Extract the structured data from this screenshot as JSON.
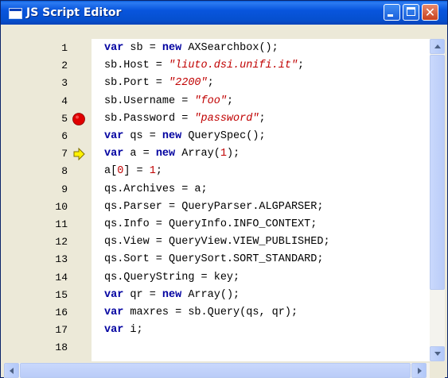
{
  "window": {
    "title": "JS Script Editor",
    "title_icon": "window-icon",
    "controls": {
      "minimize_icon": "minimize-icon",
      "maximize_icon": "maximize-icon",
      "close_icon": "close-icon",
      "close_glyph": "✕"
    }
  },
  "colors": {
    "keyword": "#0000A0",
    "string": "#C00000",
    "breakpoint": "#E00000",
    "current_line_arrow": "#FFF200"
  },
  "editor": {
    "lines": [
      {
        "n": "1",
        "marker": "",
        "tokens": [
          {
            "t": "var",
            "c": "kw"
          },
          {
            "t": " sb = "
          },
          {
            "t": "new",
            "c": "kw"
          },
          {
            "t": " AXSearchbox();"
          }
        ]
      },
      {
        "n": "2",
        "marker": "",
        "tokens": [
          {
            "t": "sb.Host = "
          },
          {
            "t": "\"liuto.dsi.unifi.it\"",
            "c": "str"
          },
          {
            "t": ";"
          }
        ]
      },
      {
        "n": "3",
        "marker": "",
        "tokens": [
          {
            "t": "sb.Port = "
          },
          {
            "t": "\"2200\"",
            "c": "str"
          },
          {
            "t": ";"
          }
        ]
      },
      {
        "n": "4",
        "marker": "",
        "tokens": [
          {
            "t": "sb.Username = "
          },
          {
            "t": "\"foo\"",
            "c": "str"
          },
          {
            "t": ";"
          }
        ]
      },
      {
        "n": "5",
        "marker": "breakpoint",
        "tokens": [
          {
            "t": "sb.Password = "
          },
          {
            "t": "\"password\"",
            "c": "str"
          },
          {
            "t": ";"
          }
        ]
      },
      {
        "n": "6",
        "marker": "",
        "tokens": [
          {
            "t": "var",
            "c": "kw"
          },
          {
            "t": " qs = "
          },
          {
            "t": "new",
            "c": "kw"
          },
          {
            "t": " QuerySpec();"
          }
        ]
      },
      {
        "n": "7",
        "marker": "current",
        "tokens": [
          {
            "t": "var",
            "c": "kw"
          },
          {
            "t": " a = "
          },
          {
            "t": "new",
            "c": "kw"
          },
          {
            "t": " Array("
          },
          {
            "t": "1",
            "c": "num"
          },
          {
            "t": ");"
          }
        ]
      },
      {
        "n": "8",
        "marker": "",
        "tokens": [
          {
            "t": "a["
          },
          {
            "t": "0",
            "c": "num"
          },
          {
            "t": "] = "
          },
          {
            "t": "1",
            "c": "num"
          },
          {
            "t": ";"
          }
        ]
      },
      {
        "n": "9",
        "marker": "",
        "tokens": [
          {
            "t": "qs.Archives = a;"
          }
        ]
      },
      {
        "n": "10",
        "marker": "",
        "tokens": [
          {
            "t": "qs.Parser = QueryParser.ALGPARSER;"
          }
        ]
      },
      {
        "n": "11",
        "marker": "",
        "tokens": [
          {
            "t": "qs.Info = QueryInfo.INFO_CONTEXT;"
          }
        ]
      },
      {
        "n": "12",
        "marker": "",
        "tokens": [
          {
            "t": "qs.View = QueryView.VIEW_PUBLISHED;"
          }
        ]
      },
      {
        "n": "13",
        "marker": "",
        "tokens": [
          {
            "t": "qs.Sort = QuerySort.SORT_STANDARD;"
          }
        ]
      },
      {
        "n": "14",
        "marker": "",
        "tokens": [
          {
            "t": "qs.QueryString = key;"
          }
        ]
      },
      {
        "n": "15",
        "marker": "",
        "tokens": [
          {
            "t": "var",
            "c": "kw"
          },
          {
            "t": " qr = "
          },
          {
            "t": "new",
            "c": "kw"
          },
          {
            "t": " Array();"
          }
        ]
      },
      {
        "n": "16",
        "marker": "",
        "tokens": [
          {
            "t": "var",
            "c": "kw"
          },
          {
            "t": " maxres = sb.Query(qs, qr);"
          }
        ]
      },
      {
        "n": "17",
        "marker": "",
        "tokens": [
          {
            "t": "var",
            "c": "kw"
          },
          {
            "t": " i;"
          }
        ]
      },
      {
        "n": "18",
        "marker": "",
        "tokens": []
      }
    ]
  },
  "scrollbars": {
    "up_icon": "scroll-up-arrow-icon",
    "down_icon": "scroll-down-arrow-icon",
    "left_icon": "scroll-left-arrow-icon",
    "right_icon": "scroll-right-arrow-icon"
  }
}
